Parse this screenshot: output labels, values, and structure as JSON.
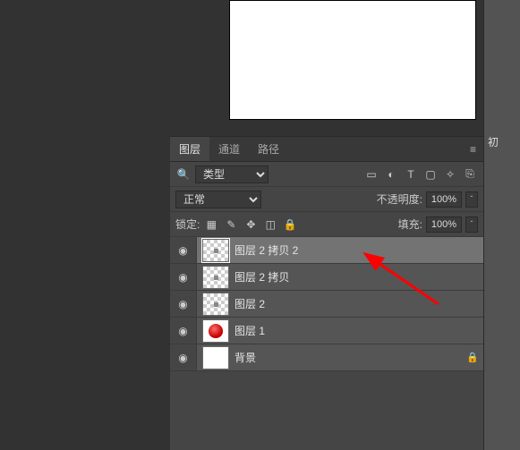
{
  "tabs": {
    "layers": "图层",
    "channels": "通道",
    "paths": "路径"
  },
  "controls": {
    "kind_label": "类型",
    "blend_mode": "正常",
    "opacity_label": "不透明度:",
    "opacity_value": "100%",
    "lock_label": "锁定:",
    "fill_label": "填充:",
    "fill_value": "100%"
  },
  "layers": [
    {
      "name": "图层 2 拷贝 2",
      "selected": true,
      "thumb": "checker",
      "locked": false
    },
    {
      "name": "图层 2 拷贝",
      "selected": false,
      "thumb": "checker",
      "locked": false
    },
    {
      "name": "图层 2",
      "selected": false,
      "thumb": "checker",
      "locked": false
    },
    {
      "name": "图层 1",
      "selected": false,
      "thumb": "apple",
      "locked": false
    },
    {
      "name": "背景",
      "selected": false,
      "thumb": "white",
      "locked": true
    }
  ],
  "right_strip_text": "初",
  "icons": {
    "search": "🔍",
    "image": "▭",
    "adjust": "◐",
    "text": "T",
    "shape": "▢",
    "smart": "✧",
    "artboard": "⎘",
    "pixel": "▦",
    "brush": "✎",
    "move": "✥",
    "crop": "◫",
    "lock": "🔒",
    "eye": "◉",
    "menu": "≡",
    "chev": "ˇ"
  }
}
